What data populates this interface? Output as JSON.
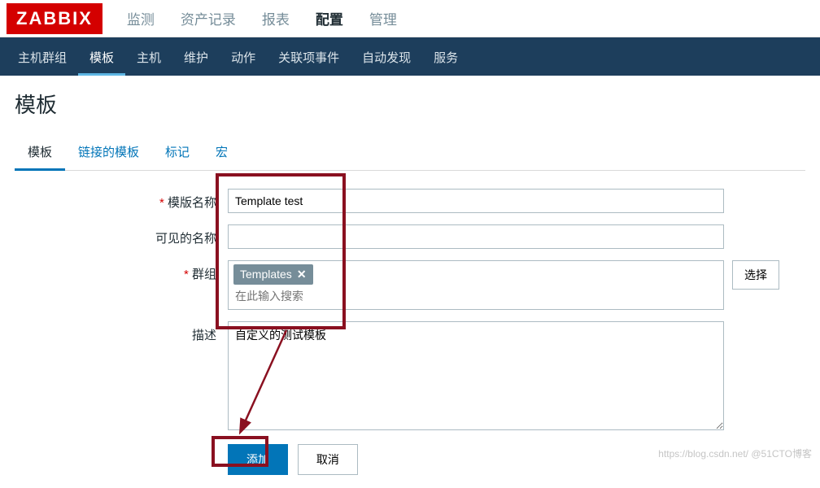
{
  "logo": "ZABBIX",
  "top_nav": {
    "items": [
      "监测",
      "资产记录",
      "报表",
      "配置",
      "管理"
    ],
    "active_index": 3
  },
  "sub_nav": {
    "items": [
      "主机群组",
      "模板",
      "主机",
      "维护",
      "动作",
      "关联项事件",
      "自动发现",
      "服务"
    ],
    "active_index": 1
  },
  "page_title": "模板",
  "tabs": {
    "items": [
      "模板",
      "链接的模板",
      "标记",
      "宏"
    ],
    "active_index": 0
  },
  "form": {
    "template_name": {
      "label": "模版名称",
      "value": "Template test"
    },
    "visible_name": {
      "label": "可见的名称",
      "value": ""
    },
    "groups": {
      "label": "群组",
      "tag": "Templates",
      "placeholder": "在此输入搜索",
      "select_btn": "选择"
    },
    "description": {
      "label": "描述",
      "value": "自定义的测试模板"
    }
  },
  "buttons": {
    "add": "添加",
    "cancel": "取消"
  },
  "watermark": "https://blog.csdn.net/  @51CTO博客"
}
